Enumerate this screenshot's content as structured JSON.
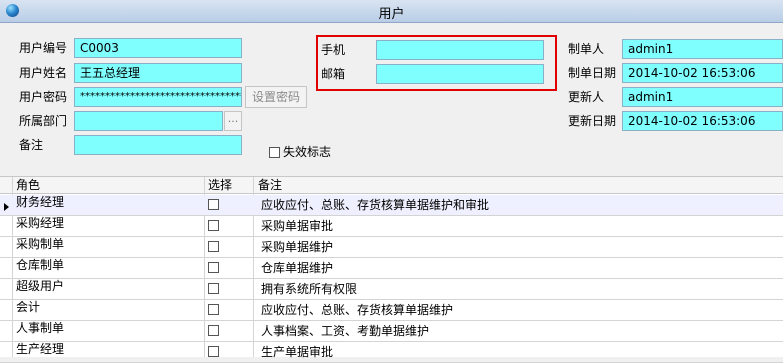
{
  "window": {
    "title": "用户"
  },
  "form": {
    "user_code_label": "用户编号",
    "user_code": "C0003",
    "user_name_label": "用户姓名",
    "user_name": "王五总经理",
    "password_label": "用户密码",
    "password": "**********************************",
    "set_password_button": "设置密码",
    "department_label": "所属部门",
    "department": "",
    "department_picker": "...",
    "remark_label": "备注",
    "remark": "",
    "phone_label": "手机",
    "phone": "",
    "email_label": "邮箱",
    "email": "",
    "creator_label": "制单人",
    "creator": "admin1",
    "create_date_label": "制单日期",
    "create_date": "2014-10-02 16:53:06",
    "updater_label": "更新人",
    "updater": "admin1",
    "update_date_label": "更新日期",
    "update_date": "2014-10-02 16:53:06",
    "disabled_label": "失效标志",
    "disabled": false
  },
  "grid": {
    "columns": [
      "角色",
      "选择",
      "备注"
    ],
    "rows": [
      {
        "role": "财务经理",
        "checked": false,
        "remark": "应收应付、总账、存货核算单据维护和审批"
      },
      {
        "role": "采购经理",
        "checked": false,
        "remark": "采购单据审批"
      },
      {
        "role": "采购制单",
        "checked": false,
        "remark": "采购单据维护"
      },
      {
        "role": "仓库制单",
        "checked": false,
        "remark": "仓库单据维护"
      },
      {
        "role": "超级用户",
        "checked": false,
        "remark": "拥有系统所有权限"
      },
      {
        "role": "会计",
        "checked": false,
        "remark": "应收应付、总账、存货核算单据维护"
      },
      {
        "role": "人事制单",
        "checked": false,
        "remark": "人事档案、工资、考勤单据维护"
      },
      {
        "role": "生产经理",
        "checked": false,
        "remark": "生产单据审批"
      }
    ]
  }
}
